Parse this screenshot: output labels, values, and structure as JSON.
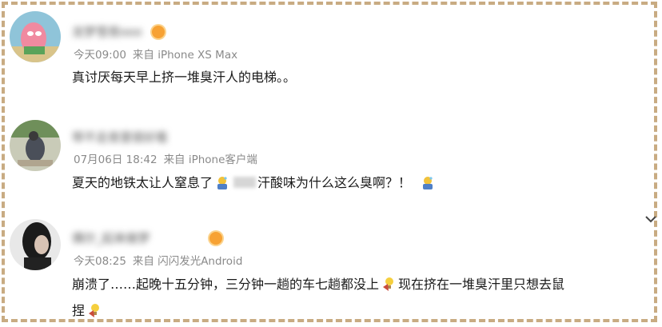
{
  "comments": [
    {
      "username": "龙梦雪夜ooo",
      "time": "今天09:00",
      "source": "来自 iPhone XS Max",
      "text": "真讨厌每天早上挤一堆臭汗人的电梯。。"
    },
    {
      "username": "带不走夜里很好看",
      "time": "07月06日 18:42",
      "source": "来自 iPhone客户端",
      "text_a": "夏天的地铁太让人窒息了",
      "text_b": "汗酸味为什么这么臭啊？！"
    },
    {
      "username": "偶尔_起来做梦",
      "time": "今天08:25",
      "source": "来自 闪闪发光Android",
      "text_a": "崩溃了……起晚十五分钟，三分钟一趟的车七趟都没上",
      "text_b": "现在挤在一堆臭汗里只想去鼠",
      "text_c": "捏"
    }
  ],
  "icons": {
    "vip_badge": "vip-badge-icon",
    "emoji_sweat": "sweat-emoji-icon",
    "emoji_doge": "doge-emoji-icon",
    "expand": "chevron-down-icon"
  },
  "colors": {
    "frame": "#c8ab82",
    "meta": "#8a8a8a",
    "text": "#1a1a1a",
    "vip": "#f7a234"
  }
}
